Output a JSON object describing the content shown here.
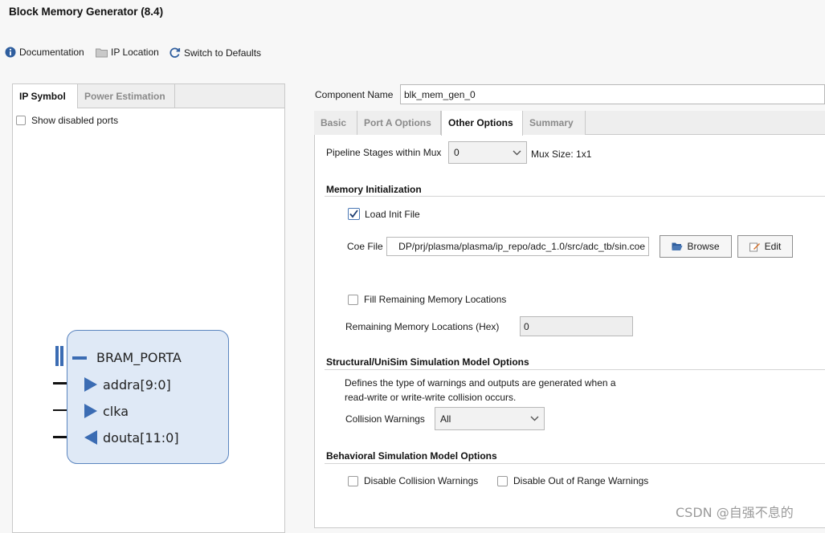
{
  "window": {
    "title": "Block Memory Generator (8.4)"
  },
  "toolbar": {
    "documentation": "Documentation",
    "ip_location": "IP Location",
    "switch_defaults": "Switch to Defaults"
  },
  "left_tabs": {
    "ip_symbol": "IP Symbol",
    "power_estimation": "Power Estimation"
  },
  "show_disabled_ports": {
    "label": "Show disabled ports",
    "checked": false
  },
  "ip_symbol": {
    "interface": "BRAM_PORTA",
    "ports": {
      "addra": "addra[9:0]",
      "clka": "clka",
      "douta": "douta[11:0]"
    }
  },
  "component": {
    "label": "Component Name",
    "value": "blk_mem_gen_0"
  },
  "right_tabs": {
    "basic": "Basic",
    "port_a": "Port A Options",
    "other": "Other Options",
    "summary": "Summary",
    "active": "Other Options"
  },
  "pipeline": {
    "label": "Pipeline Stages within Mux",
    "value": "0",
    "mux_size": "Mux Size: 1x1"
  },
  "memory_init": {
    "title": "Memory Initialization",
    "load_init_label": "Load Init File",
    "load_init_checked": true,
    "coe_label": "Coe File",
    "coe_value": "DP/prj/plasma/plasma/ip_repo/adc_1.0/src/adc_tb/sin.coe",
    "browse": "Browse",
    "edit": "Edit",
    "fill_label": "Fill Remaining Memory Locations",
    "fill_checked": false,
    "remaining_label": "Remaining Memory Locations (Hex)",
    "remaining_value": "0"
  },
  "structural": {
    "title": "Structural/UniSim Simulation Model Options",
    "desc1": "Defines the type of warnings and outputs are generated when a",
    "desc2": "read-write or write-write collision occurs.",
    "collision_label": "Collision Warnings",
    "collision_value": "All"
  },
  "behavioral": {
    "title": "Behavioral Simulation Model Options",
    "disable_collision": "Disable Collision Warnings",
    "disable_out_of_range": "Disable Out of Range Warnings"
  },
  "watermark": "CSDN @自强不息的",
  "colors": {
    "accent": "#3b6cb3",
    "symbol_fill": "#dfe9f6",
    "symbol_border": "#5b85bf"
  }
}
